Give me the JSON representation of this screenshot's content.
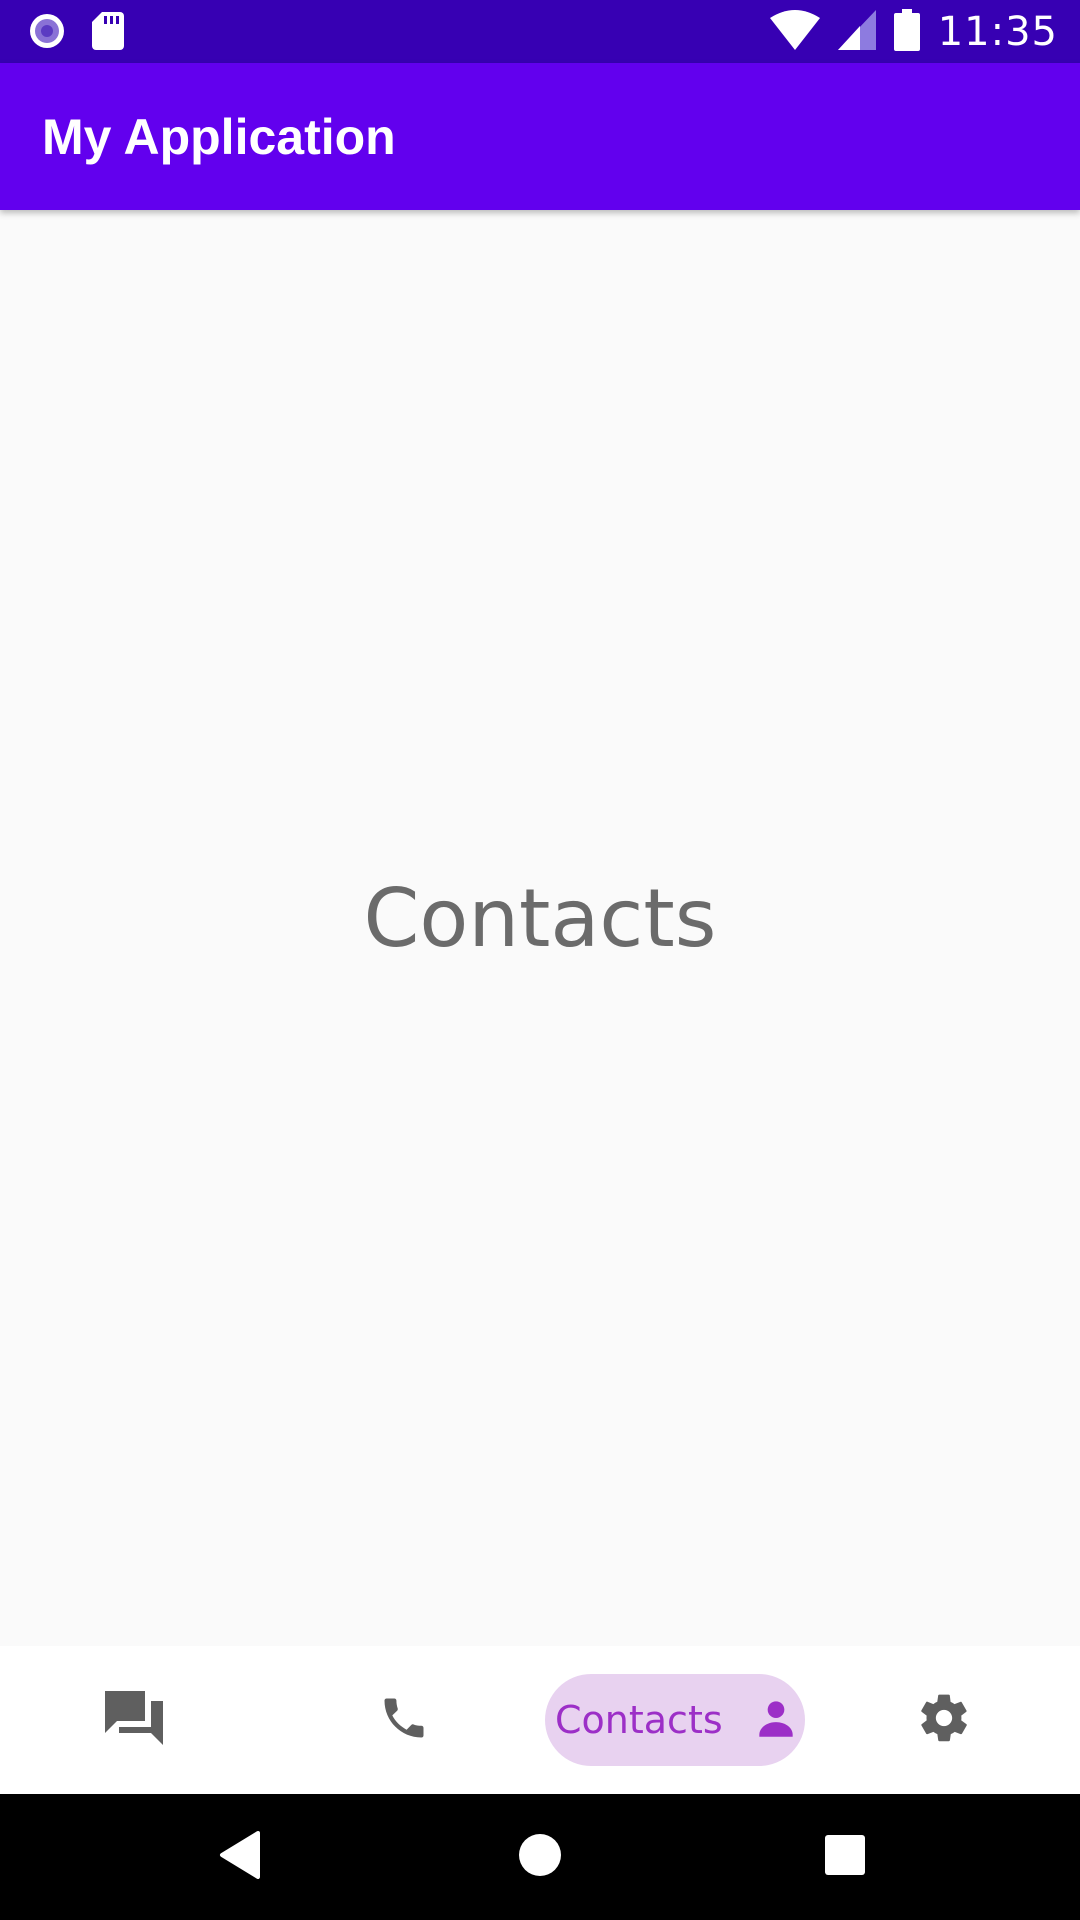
{
  "status_bar": {
    "time": "11:35",
    "icons": [
      "radio-button-icon",
      "sd-card-icon",
      "wifi-icon",
      "cellular-signal-icon",
      "battery-icon"
    ]
  },
  "app_bar": {
    "title": "My Application",
    "background": "#6200ee"
  },
  "content": {
    "title": "Contacts"
  },
  "bottom_nav": {
    "items": [
      {
        "icon": "chat-icon",
        "label": "",
        "selected": false
      },
      {
        "icon": "phone-icon",
        "label": "",
        "selected": false
      },
      {
        "icon": "person-icon",
        "label": "Contacts",
        "selected": true
      },
      {
        "icon": "gear-icon",
        "label": "",
        "selected": false
      }
    ],
    "selected_color": "#9c2fc7",
    "selected_bg": "#e8d2f0"
  },
  "system_nav": {
    "buttons": [
      "back-icon",
      "home-icon",
      "recents-icon"
    ]
  }
}
